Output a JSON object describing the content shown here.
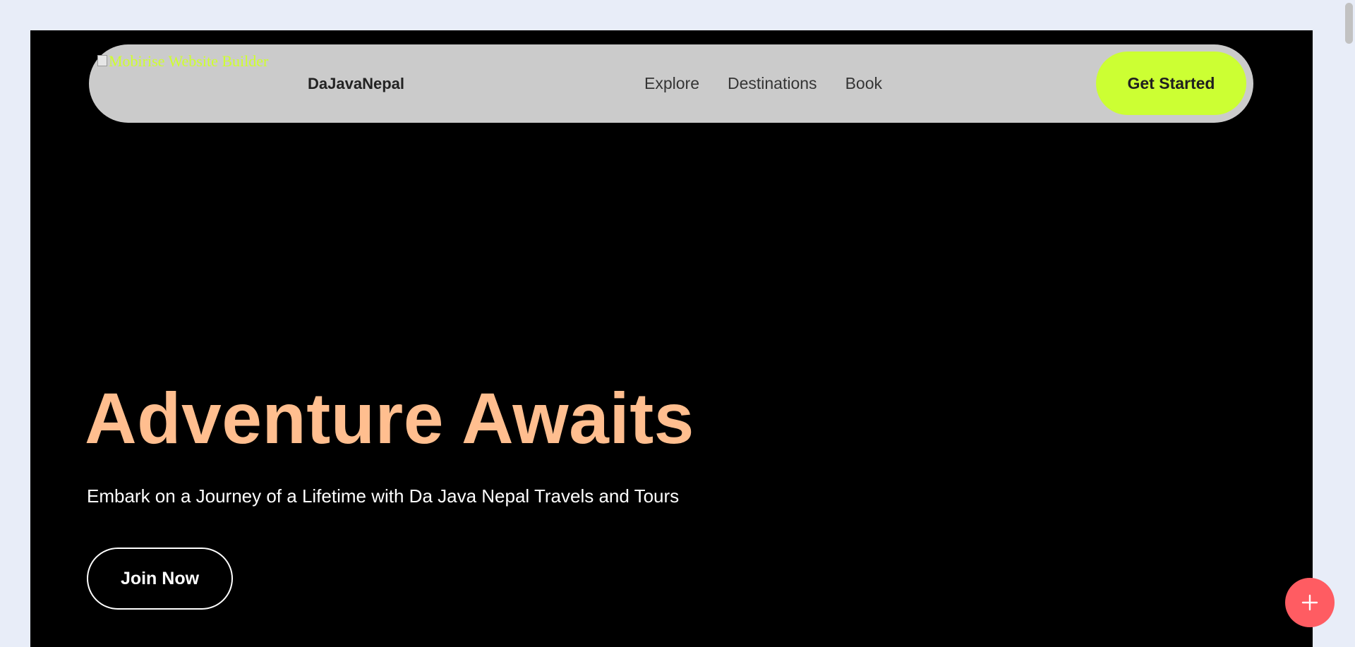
{
  "header": {
    "logo_alt": "Mobirise Website Builder",
    "brand": "DaJavaNepal",
    "nav": [
      {
        "label": "Explore"
      },
      {
        "label": "Destinations"
      },
      {
        "label": "Book"
      }
    ],
    "cta_label": "Get Started"
  },
  "hero": {
    "title": "Adventure Awaits",
    "subtitle": "Embark on a Journey of a Lifetime with Da Java Nepal Travels and Tours",
    "button_label": "Join Now"
  },
  "fab": {
    "icon": "plus-icon"
  },
  "colors": {
    "page_background": "#e8edf8",
    "hero_background": "#000000",
    "navbar_background": "#cbcbcb",
    "accent_lime": "#ccff33",
    "title_peach": "#ffbe8f",
    "fab_red": "#ff5c62"
  }
}
